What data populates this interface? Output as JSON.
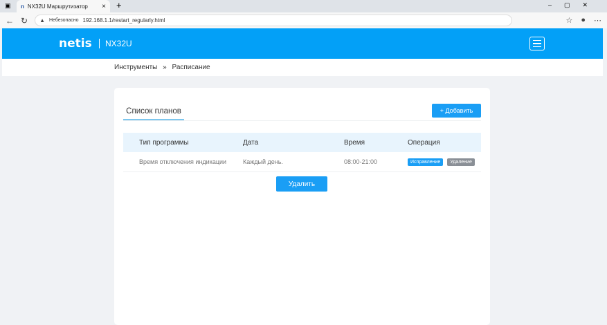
{
  "browser": {
    "tab_title": "NX32U Маршрутизатор",
    "security": "Небезопасно",
    "url": "192.168.1.1/restart_regularly.html"
  },
  "header": {
    "logo": "netis",
    "model": "NX32U"
  },
  "breadcrumb": {
    "parent": "Инструменты",
    "sep": "»",
    "current": "Расписание"
  },
  "card": {
    "title": "Список планов",
    "add_label": "+ Добавить",
    "columns": [
      "Тип программы",
      "Дата",
      "Время",
      "Операция"
    ],
    "rows": [
      {
        "type": "Время отключения индикации",
        "date": "Каждый день.",
        "time": "08:00-21:00",
        "edit": "Исправление",
        "remove": "Удаление"
      }
    ],
    "delete_label": "Удалить"
  }
}
